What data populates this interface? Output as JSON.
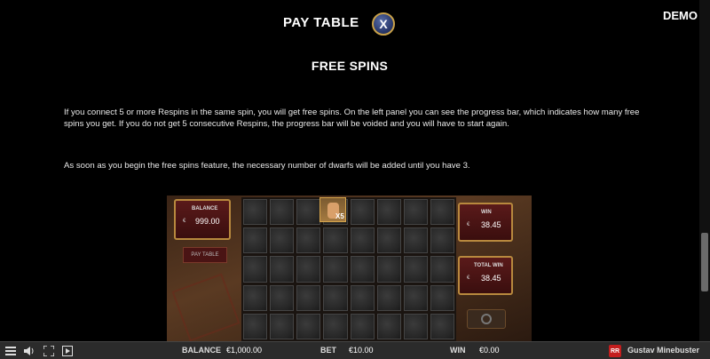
{
  "header": {
    "title": "PAY TABLE",
    "close_icon": "X",
    "demo_label": "DEMO"
  },
  "content": {
    "section_title": "FREE SPINS",
    "paragraphs": [
      "If you connect 5 or more Respins in the same spin, you will get free spins. On the left panel you can see the progress bar, which indicates how many free spins you get. If you do not get 5 consecutive Respins, the progress bar will be voided and you will have to start again.",
      "As soon as you begin the free spins feature, the necessary number of dwarfs will be added until you have 3."
    ]
  },
  "preview": {
    "balance_label": "BALANCE",
    "balance_currency": "€",
    "balance_value": "999.00",
    "paytable_label": "PAY TABLE",
    "multiplier": "X5",
    "win_label": "WIN",
    "win_currency": "€",
    "win_value": "38.45",
    "total_win_label": "TOTAL WIN",
    "total_win_currency": "€",
    "total_win_value": "38.45"
  },
  "bottom_bar": {
    "icons": [
      "menu-icon",
      "sound-icon",
      "fullscreen-icon",
      "play-icon"
    ],
    "balance_label": "BALANCE",
    "balance_value": "€1,000.00",
    "bet_label": "BET",
    "bet_value": "€10.00",
    "win_label": "WIN",
    "win_value": "€0.00",
    "logo_text": "RR",
    "game_name": "Gustav Minebuster"
  },
  "colors": {
    "accent_gold": "#c9a24a",
    "panel_red": "#5a1a1a",
    "brand_red": "#c41e1e"
  }
}
